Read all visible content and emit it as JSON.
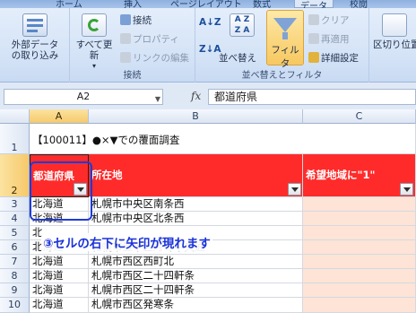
{
  "ribbon_tabs": [
    "ホーム",
    "挿入",
    "ページレイアウト",
    "数式",
    "データ",
    "校閲"
  ],
  "groups": {
    "external": {
      "label": "外部データの取り込み"
    },
    "connections": {
      "label": "接続",
      "refresh": "すべて更新",
      "connect": "接続",
      "properties": "プロパティ",
      "edit_links": "リンクの編集"
    },
    "sort_filter": {
      "label": "並べ替えとフィルタ",
      "sort": "並べ替え",
      "filter": "フィルタ",
      "clear": "クリア",
      "reapply": "再適用",
      "advanced": "詳細設定"
    },
    "data_tools": {
      "label": "区切り位置"
    }
  },
  "formula_bar": {
    "name_box": "A2",
    "fx": "fx",
    "formula": "都道府県"
  },
  "columns": [
    "A",
    "B",
    "C"
  ],
  "rows": [
    {
      "num": "1",
      "a": "【100011】●×▼での覆面調査",
      "b": "",
      "c": ""
    },
    {
      "num": "2",
      "a": "都道府県",
      "b": "所在地",
      "c": "希望地域に\"1\""
    },
    {
      "num": "3",
      "a": "北海道",
      "b": "札幌市中央区南条西",
      "c": ""
    },
    {
      "num": "4",
      "a": "北海道",
      "b": "札幌市中央区北条西",
      "c": ""
    },
    {
      "num": "5",
      "a": "北",
      "b": "",
      "c": ""
    },
    {
      "num": "6",
      "a": "北海道",
      "b": "札幌市豊平区月寒中央通",
      "c": ""
    },
    {
      "num": "7",
      "a": "北海道",
      "b": "札幌市西区西町北",
      "c": ""
    },
    {
      "num": "8",
      "a": "北海道",
      "b": "札幌市西区二十四軒条",
      "c": ""
    },
    {
      "num": "9",
      "a": "北海道",
      "b": "札幌市西区二十四軒条",
      "c": ""
    },
    {
      "num": "10",
      "a": "北海道",
      "b": "札幌市西区発寒条",
      "c": ""
    }
  ],
  "callout": "③セルの右下に矢印が現れます",
  "colors": {
    "header_red": "#ff2b2b",
    "callout_blue": "#1a32d9",
    "peach": "#fde4d6"
  }
}
